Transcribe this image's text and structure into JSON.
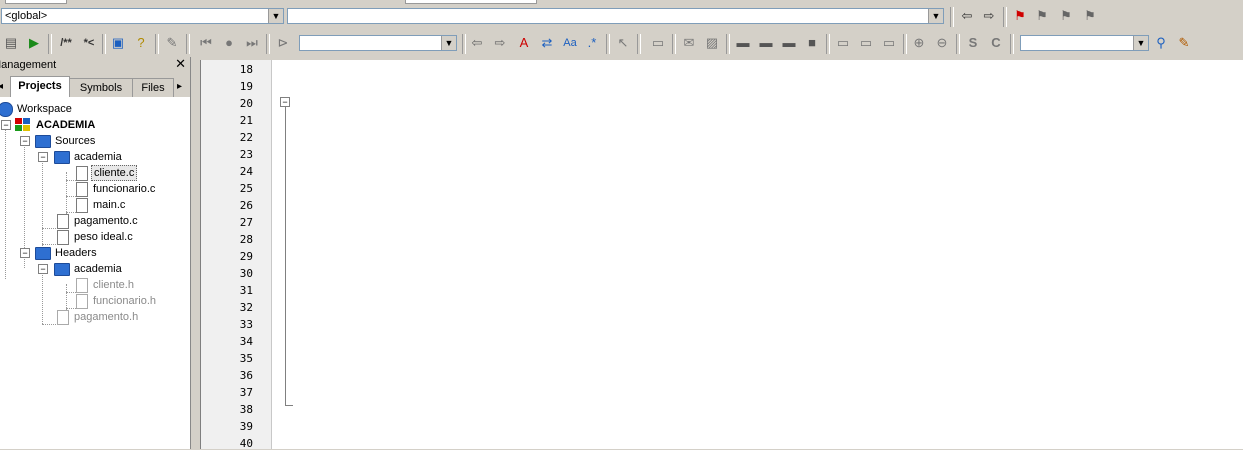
{
  "toolbar1": {
    "scope_combo": "<global>",
    "function_combo": "",
    "icons": [
      "back-arrow-icon",
      "forward-arrow-icon",
      "bookmark-red-icon",
      "bookmark-prev-icon",
      "bookmark-next-icon",
      "bookmark-clear-icon"
    ]
  },
  "toolbar2": {
    "comment_label": "/**",
    "uncomment_label": "*<",
    "search_combo": "",
    "find_combo": "",
    "s_label": "S",
    "c_label": "C"
  },
  "panel": {
    "title": "Management",
    "close": "✕",
    "tabs": [
      "Projects",
      "Symbols",
      "Files"
    ],
    "tab_left_arrow": "◂",
    "tab_right_arrow": "▸"
  },
  "tree": {
    "workspace": "Workspace",
    "project": "ACADEMIA",
    "sources": "Sources",
    "academia_src": "academia",
    "files_src": [
      "cliente.c",
      "funcionario.c",
      "main.c"
    ],
    "pagamento_c": "pagamento.c",
    "peso_ideal_c": "peso ideal.c",
    "headers": "Headers",
    "academia_hdr": "academia",
    "files_hdr": [
      "cliente.h",
      "funcionario.h"
    ],
    "pagamento_h": "pagamento.h"
  },
  "editor": {
    "line_numbers": [
      "18",
      "19",
      "20",
      "21",
      "22",
      "23",
      "24",
      "25",
      "26",
      "27",
      "28",
      "29",
      "30",
      "31",
      "32",
      "33",
      "34",
      "35",
      "36",
      "37",
      "38",
      "39",
      "40"
    ],
    "fold_symbol": "−"
  }
}
